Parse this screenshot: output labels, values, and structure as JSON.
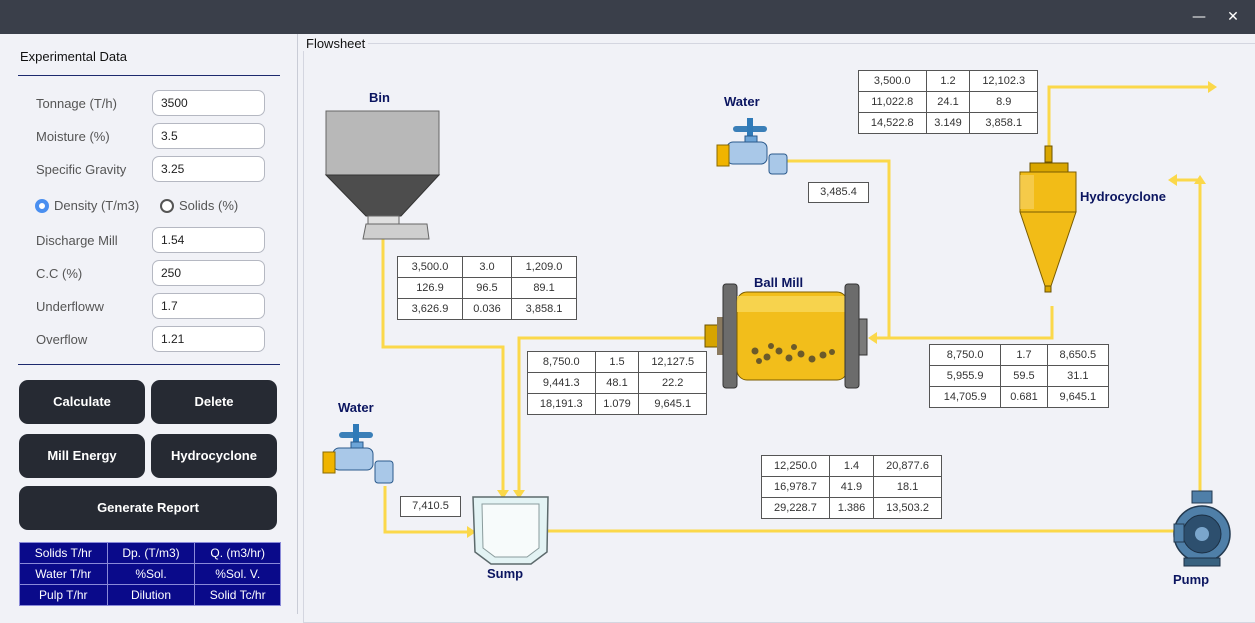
{
  "window": {
    "close": "✕",
    "minimize": "—"
  },
  "panel": {
    "title": "Experimental Data",
    "fields": [
      {
        "label": "Tonnage (T/h)",
        "value": "3500"
      },
      {
        "label": "Moisture (%)",
        "value": "3.5"
      },
      {
        "label": "Specific Gravity",
        "value": "3.25"
      }
    ],
    "radio": {
      "density": "Density (T/m3)",
      "solids": "Solids (%)",
      "selected": "density"
    },
    "fields2": [
      {
        "label": "Discharge Mill",
        "value": "1.54"
      },
      {
        "label": "C.C (%)",
        "value": "250"
      },
      {
        "label": "Underfloww",
        "value": "1.7"
      },
      {
        "label": "Overflow",
        "value": "1.21"
      }
    ],
    "buttons": {
      "calculate": "Calculate",
      "delete": "Delete",
      "mill_energy": "Mill Energy",
      "hydrocyclone": "Hydrocyclone",
      "generate_report": "Generate Report"
    },
    "legend": [
      [
        "Solids T/hr",
        "Dp. (T/m3)",
        "Q. (m3/hr)"
      ],
      [
        "Water T/hr",
        "%Sol.",
        "%Sol. V."
      ],
      [
        "Pulp T/hr",
        "Dilution",
        "Solid Tc/hr"
      ]
    ]
  },
  "flowsheet": {
    "title": "Flowsheet",
    "labels": {
      "bin": "Bin",
      "water1": "Water",
      "water2": "Water",
      "ball_mill": "Ball Mill",
      "hydrocyclone": "Hydrocyclone",
      "sump": "Sump",
      "pump": "Pump"
    },
    "water_mill_value": "3,485.4",
    "water_sump_value": "7,410.5",
    "tables": {
      "overflow": [
        [
          "3,500.0",
          "1.2",
          "12,102.3"
        ],
        [
          "11,022.8",
          "24.1",
          "8.9"
        ],
        [
          "14,522.8",
          "3.149",
          "3,858.1"
        ]
      ],
      "bin_feed": [
        [
          "3,500.0",
          "3.0",
          "1,209.0"
        ],
        [
          "126.9",
          "96.5",
          "89.1"
        ],
        [
          "3,626.9",
          "0.036",
          "3,858.1"
        ]
      ],
      "mill_discharge": [
        [
          "8,750.0",
          "1.5",
          "12,127.5"
        ],
        [
          "9,441.3",
          "48.1",
          "22.2"
        ],
        [
          "18,191.3",
          "1.079",
          "9,645.1"
        ]
      ],
      "underflow": [
        [
          "8,750.0",
          "1.7",
          "8,650.5"
        ],
        [
          "5,955.9",
          "59.5",
          "31.1"
        ],
        [
          "14,705.9",
          "0.681",
          "9,645.1"
        ]
      ],
      "pump_feed": [
        [
          "12,250.0",
          "1.4",
          "20,877.6"
        ],
        [
          "16,978.7",
          "41.9",
          "18.1"
        ],
        [
          "29,228.7",
          "1.386",
          "13,503.2"
        ]
      ]
    },
    "colors": {
      "stream": "#fbd84a",
      "equipment": "#f0b400",
      "label": "#0b1560"
    }
  }
}
